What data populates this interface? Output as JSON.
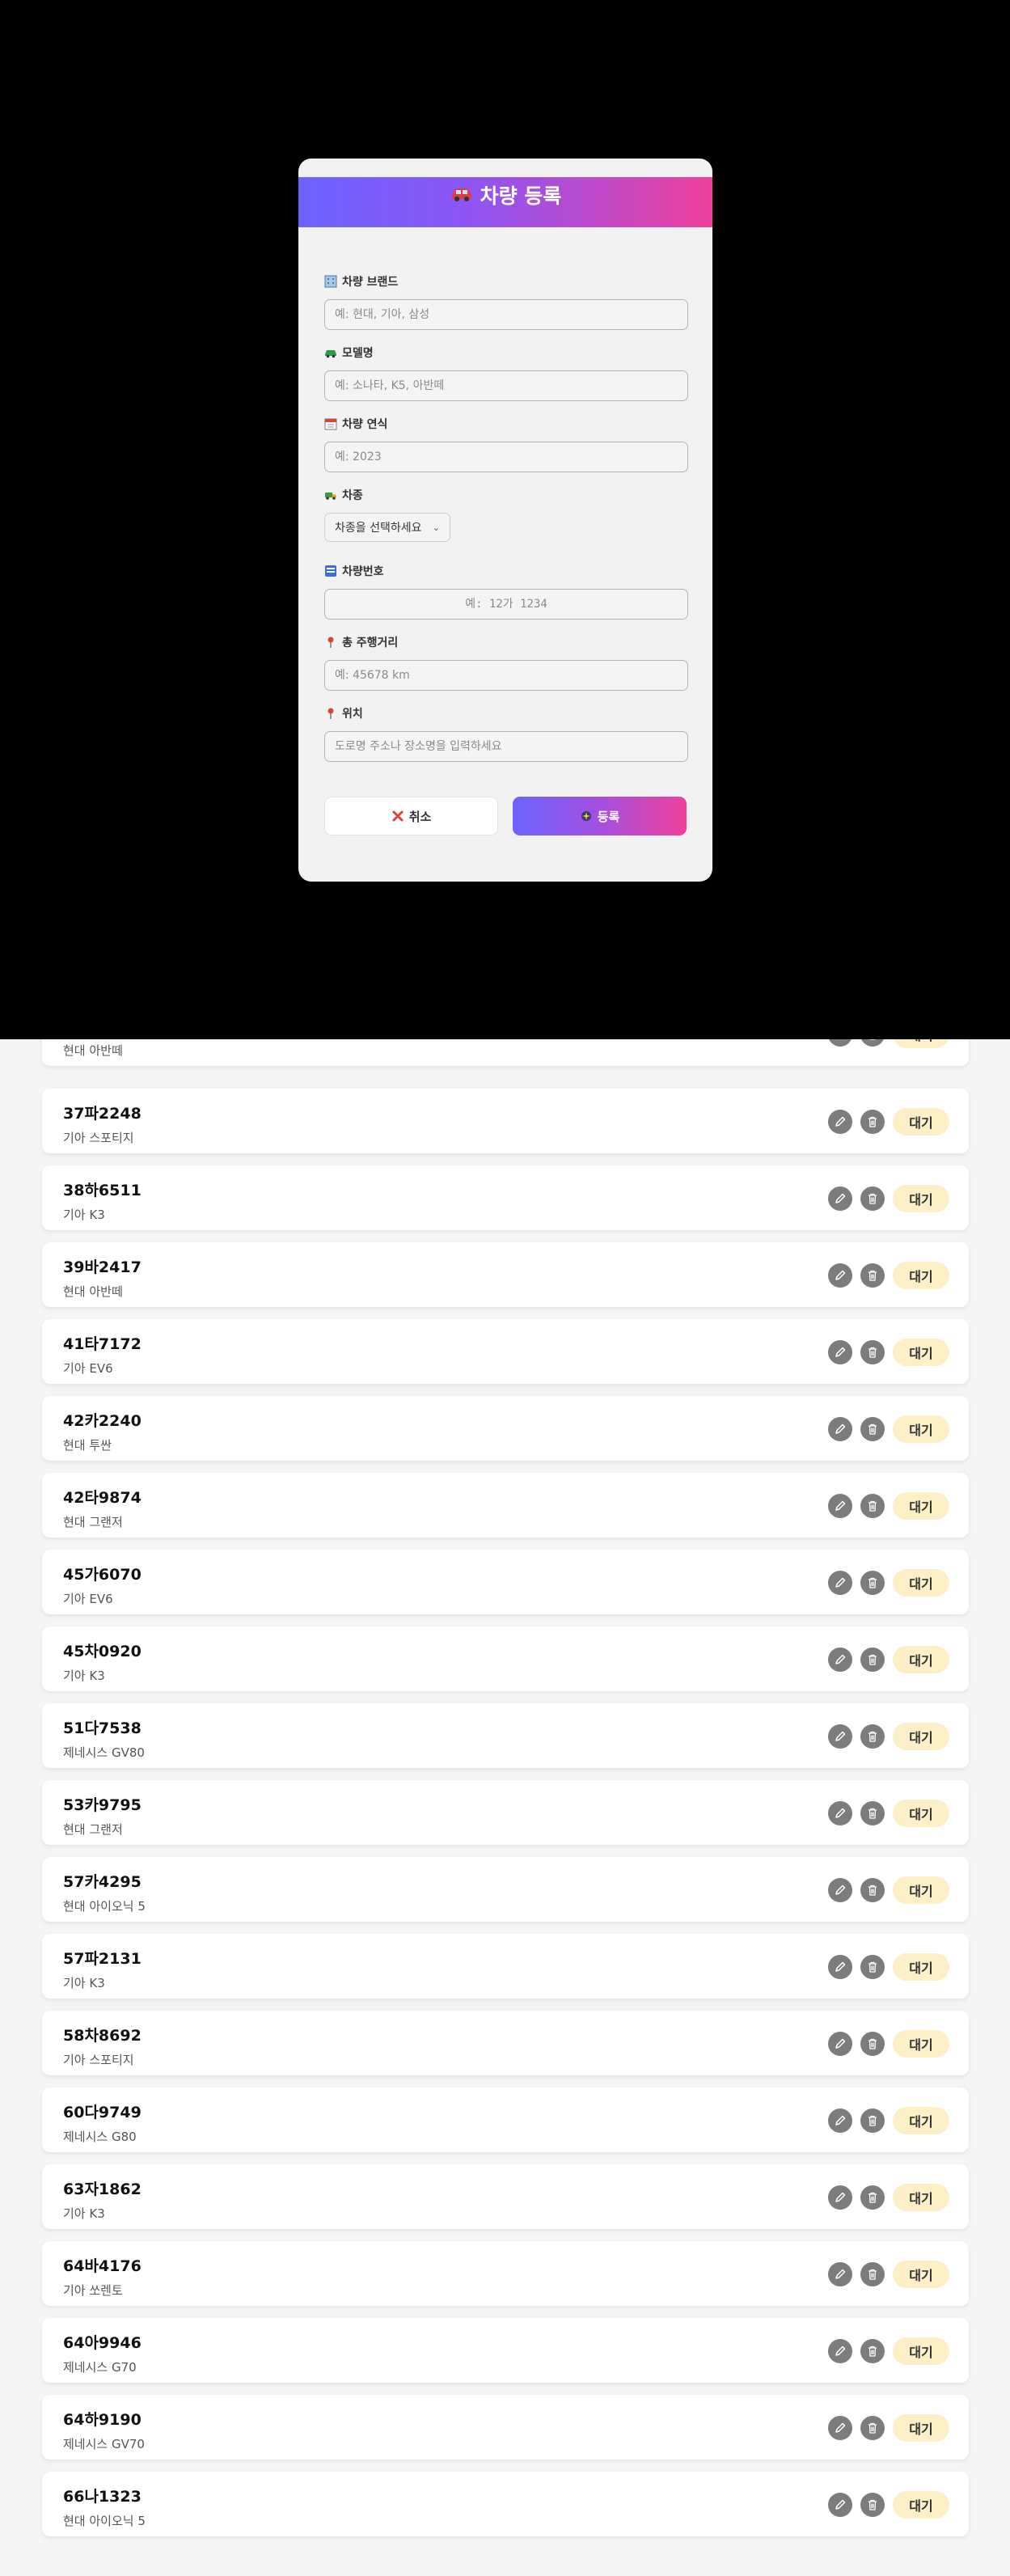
{
  "modal": {
    "title": "차량 등록",
    "fields": {
      "brand": {
        "label": "차량 브랜드",
        "placeholder": "예: 현대, 기아, 삼성"
      },
      "model": {
        "label": "모델명",
        "placeholder": "예: 소나타, K5, 아반떼"
      },
      "year": {
        "label": "차량 연식",
        "placeholder": "예: 2023"
      },
      "type": {
        "label": "차종",
        "selected": "차종을 선택하세요"
      },
      "plate": {
        "label": "차량번호",
        "placeholder": "예: 12가 1234"
      },
      "mileage": {
        "label": "총 주행거리",
        "placeholder": "예: 45678 km"
      },
      "location": {
        "label": "위치",
        "placeholder": "도로명 주소나 장소명을 입력하세요"
      }
    },
    "buttons": {
      "cancel": "취소",
      "submit": "등록"
    }
  },
  "vehicles": [
    {
      "plate": "",
      "model": "현대 아반떼",
      "status": "대기"
    },
    {
      "plate": "37파2248",
      "model": "기아 스포티지",
      "status": "대기"
    },
    {
      "plate": "38하6511",
      "model": "기아 K3",
      "status": "대기"
    },
    {
      "plate": "39바2417",
      "model": "현대 아반떼",
      "status": "대기"
    },
    {
      "plate": "41타7172",
      "model": "기아 EV6",
      "status": "대기"
    },
    {
      "plate": "42카2240",
      "model": "현대 투싼",
      "status": "대기"
    },
    {
      "plate": "42타9874",
      "model": "현대 그랜저",
      "status": "대기"
    },
    {
      "plate": "45가6070",
      "model": "기아 EV6",
      "status": "대기"
    },
    {
      "plate": "45차0920",
      "model": "기아 K3",
      "status": "대기"
    },
    {
      "plate": "51다7538",
      "model": "제네시스 GV80",
      "status": "대기"
    },
    {
      "plate": "53카9795",
      "model": "현대 그랜저",
      "status": "대기"
    },
    {
      "plate": "57카4295",
      "model": "현대 아이오닉 5",
      "status": "대기"
    },
    {
      "plate": "57파2131",
      "model": "기아 K3",
      "status": "대기"
    },
    {
      "plate": "58차8692",
      "model": "기아 스포티지",
      "status": "대기"
    },
    {
      "plate": "60다9749",
      "model": "제네시스 G80",
      "status": "대기"
    },
    {
      "plate": "63자1862",
      "model": "기아 K3",
      "status": "대기"
    },
    {
      "plate": "64바4176",
      "model": "기아 쏘렌토",
      "status": "대기"
    },
    {
      "plate": "64아9946",
      "model": "제네시스 G70",
      "status": "대기"
    },
    {
      "plate": "64하9190",
      "model": "제네시스 GV70",
      "status": "대기"
    },
    {
      "plate": "66나1323",
      "model": "현대 아이오닉 5",
      "status": "대기"
    }
  ]
}
